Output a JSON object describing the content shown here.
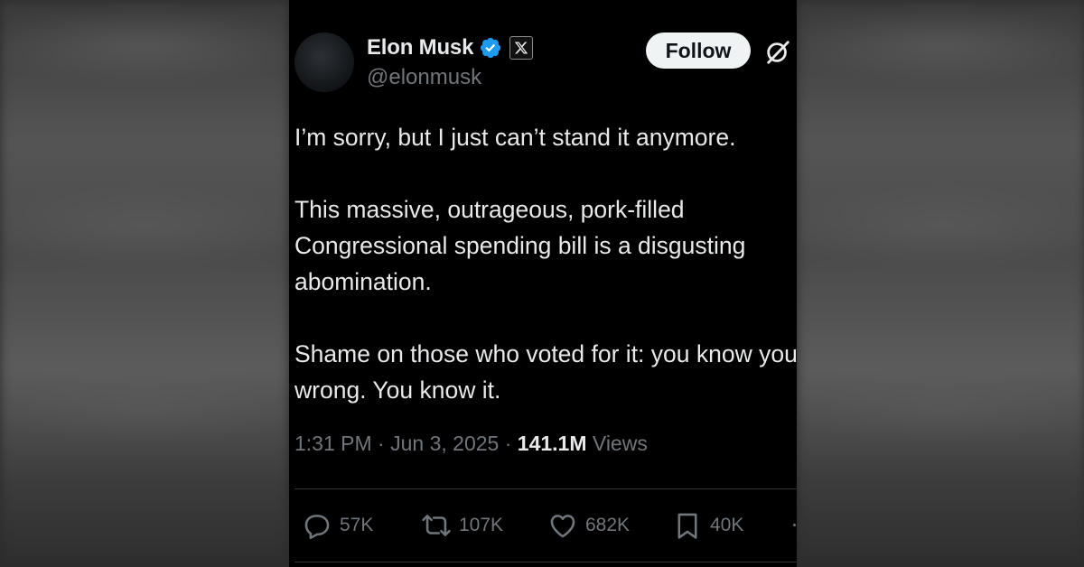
{
  "author": {
    "display_name": "Elon Musk",
    "handle": "@elonmusk",
    "badge_icon": "x-logo-icon",
    "verified_color": "#1d9bf0"
  },
  "follow_button": {
    "label": "Follow"
  },
  "tweet": {
    "text": "I’m sorry, but I just can’t stand it anymore.\n\nThis massive, outrageous, pork-filled Congressional spending bill is a disgusting abomination.\n\nShame on those who voted for it: you know you did wrong. You know it."
  },
  "meta": {
    "time": "1:31 PM",
    "date": "Jun 3, 2025",
    "separator": "·",
    "views_count": "141.1M",
    "views_label": "Views"
  },
  "actions": {
    "replies": "57K",
    "reposts": "107K",
    "likes": "682K",
    "bookmarks": "40K"
  },
  "colors": {
    "background": "#000000",
    "text": "#e7e9ea",
    "muted": "#71767b",
    "follow_bg": "#eff3f4"
  }
}
